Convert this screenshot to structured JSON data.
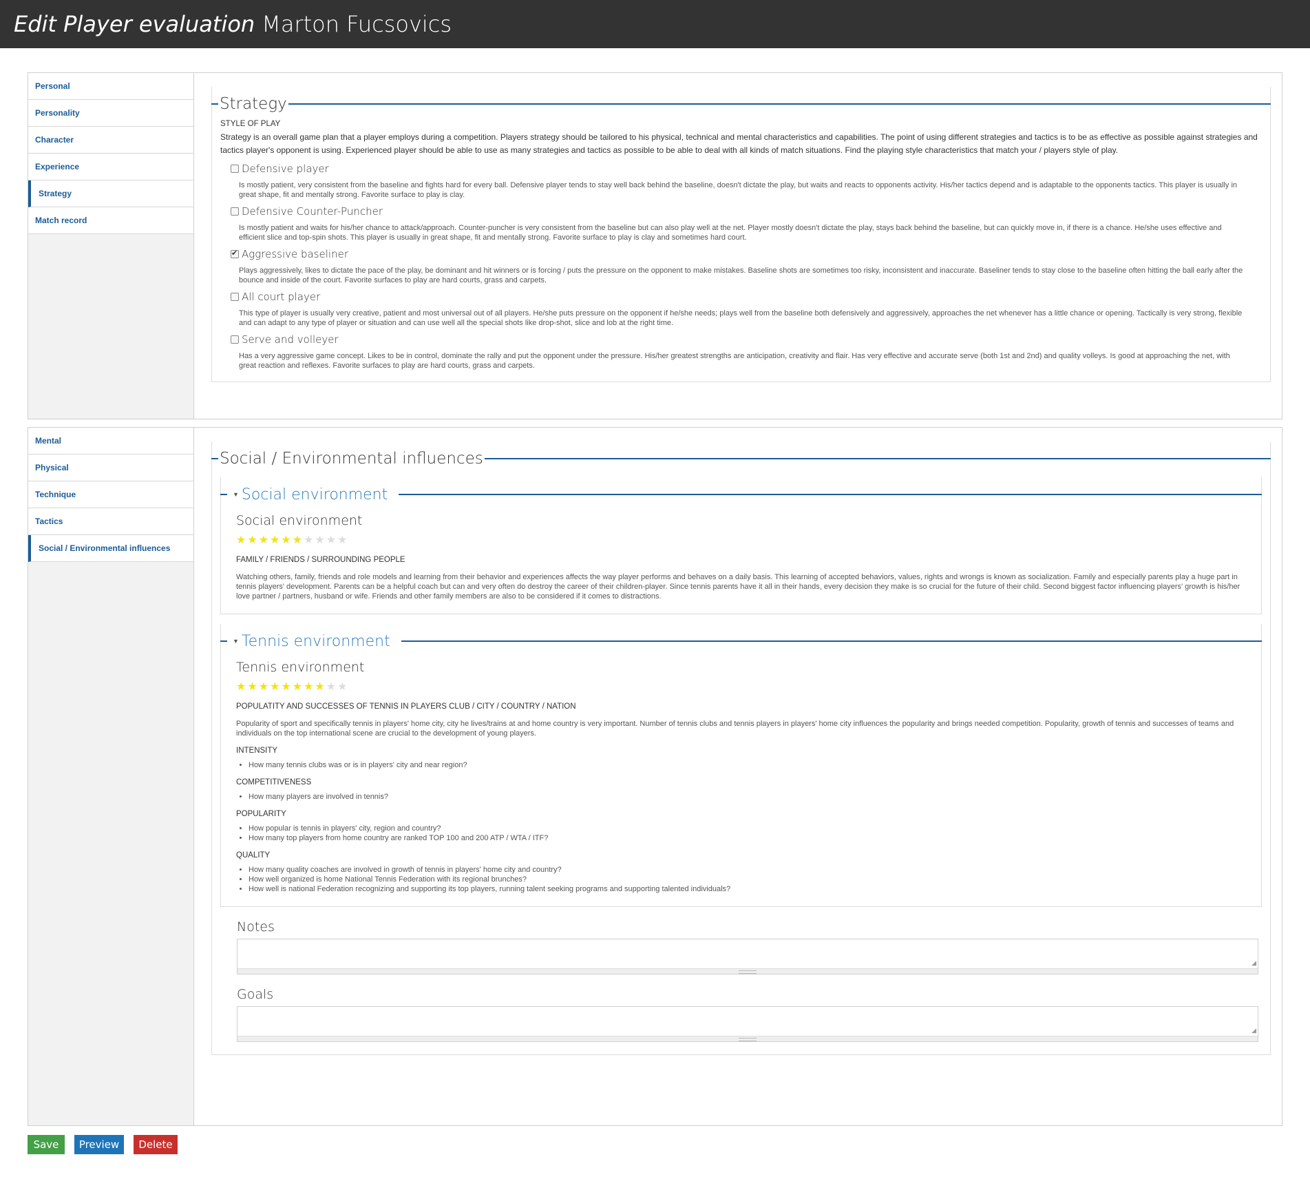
{
  "header": {
    "title": "Edit Player evaluation",
    "player_name": "Marton Fucsovics"
  },
  "nav1": {
    "items": [
      {
        "label": "Personal",
        "active": false
      },
      {
        "label": "Personality",
        "active": false
      },
      {
        "label": "Character",
        "active": false
      },
      {
        "label": "Experience",
        "active": false
      },
      {
        "label": "Strategy",
        "active": true
      },
      {
        "label": "Match record",
        "active": false
      }
    ]
  },
  "strategy": {
    "legend": "Strategy",
    "subheading": "STYLE OF PLAY",
    "intro": "Strategy is an overall game plan that a player employs during a competition. Players strategy should be tailored to his physical, technical and mental characteristics and capabilities. The point of using different strategies and tactics is to be as effective as possible against strategies and tactics player's opponent is using. Experienced player should be able to use as many strategies and tactics as possible to be able to deal with all kinds of match situations. Find the playing style characteristics that match your / players style of play.",
    "options": [
      {
        "label": "Defensive player",
        "checked": false,
        "desc": "Is mostly patient, very consistent from the baseline and fights hard for every ball. Defensive player tends to stay well back behind the baseline, doesn't dictate the play, but waits and reacts to opponents activity. His/her tactics depend and is adaptable to the opponents tactics. This player is usually in great shape, fit and mentally strong. Favorite surface to play is clay."
      },
      {
        "label": "Defensive Counter-Puncher",
        "checked": false,
        "desc": "Is mostly patient and waits for his/her chance to attack/approach. Counter-puncher is very consistent from the baseline but can also play well at the net. Player mostly doesn't dictate the play, stays back behind the baseline, but can quickly move in, if there is a chance. He/she uses effective and efficient slice and top-spin shots. This player is usually in great shape, fit and mentally strong. Favorite surface to play is clay and sometimes hard court."
      },
      {
        "label": "Aggressive baseliner",
        "checked": true,
        "desc": "Plays aggressively, likes to dictate the pace of the play, be dominant and hit winners or is forcing / puts the pressure on the opponent to make mistakes. Baseline shots are sometimes too risky, inconsistent and inaccurate. Baseliner tends to stay close to the baseline often hitting the ball early after the bounce and inside of the court. Favorite surfaces to play are hard courts, grass and carpets."
      },
      {
        "label": "All court player",
        "checked": false,
        "desc": "This type of player is usually very creative, patient and most universal out of all players. He/she puts pressure on the opponent if he/she needs; plays well from the baseline both defensively and aggressively, approaches the net whenever has a little chance or opening. Tactically is very strong, flexible and can adapt to any type of player or situation and can use well all the special shots like drop-shot, slice and lob at the right time."
      },
      {
        "label": "Serve and volleyer",
        "checked": false,
        "desc": "Has a very aggressive game concept. Likes to be in control, dominate the rally and put the opponent under the pressure. His/her greatest strengths are anticipation, creativity and flair. Has very effective and accurate serve (both 1st and 2nd) and quality volleys. Is good at approaching the net, with great reaction and reflexes. Favorite surfaces to play are hard courts, grass and carpets."
      }
    ]
  },
  "nav2": {
    "items": [
      {
        "label": "Mental",
        "active": false
      },
      {
        "label": "Physical",
        "active": false
      },
      {
        "label": "Technique",
        "active": false
      },
      {
        "label": "Tactics",
        "active": false
      },
      {
        "label": "Social / Environmental influences",
        "active": true
      }
    ]
  },
  "social": {
    "legend": "Social / Environmental influences",
    "social_env": {
      "legend": "Social environment",
      "title": "Social environment",
      "rating": 6,
      "max_rating": 10,
      "upper": "FAMILY / FRIENDS / SURROUNDING PEOPLE",
      "desc": "Watching others, family, friends and role models and learning from their behavior and experiences affects the way player performs and behaves on a daily basis. This learning of accepted behaviors, values, rights and wrongs is known as socialization. Family and especially parents play a huge part in tennis players' development. Parents can be a helpful coach but can and very often do destroy the career of their children-player. Since tennis parents have it all in their hands, every decision they make is so crucial for the future of their child. Second biggest factor influencing players' growth is his/her love partner / partners, husband or wife. Friends and other family members are also to be considered if it comes to distractions."
    },
    "tennis_env": {
      "legend": "Tennis environment",
      "title": "Tennis environment",
      "rating": 8,
      "max_rating": 10,
      "upper": "POPULATITY AND SUCCESSES OF TENNIS IN PLAYERS CLUB / CITY / COUNTRY / NATION",
      "desc": "Popularity of sport and specifically tennis in players' home city, city he lives/trains at and home country is very important. Number of tennis clubs and tennis players in players' home city influences the popularity and brings needed competition. Popularity, growth of tennis and successes of teams and individuals on the top international scene are crucial to the development of young players.",
      "groups": [
        {
          "heading": "INTENSITY",
          "items": [
            "How many tennis clubs was or is in players' city and near region?"
          ]
        },
        {
          "heading": "COMPETITIVENESS",
          "items": [
            "How many players are involved in tennis?"
          ]
        },
        {
          "heading": "POPULARITY",
          "items": [
            "How popular is tennis in players' city, region and country?",
            "How many top players from home country are ranked TOP 100 and 200 ATP / WTA / ITF?"
          ]
        },
        {
          "heading": "QUALITY",
          "items": [
            "How many quality coaches are involved in growth of tennis in players' home city and country?",
            "How well organized is home National Tennis Federation with its regional brunches?",
            "How well is national Federation recognizing and supporting its top players, running talent seeking programs and supporting talented individuals?"
          ]
        }
      ]
    },
    "notes_label": "Notes",
    "notes_value": "",
    "goals_label": "Goals",
    "goals_value": ""
  },
  "actions": {
    "save": "Save",
    "preview": "Preview",
    "delete": "Delete"
  },
  "colors": {
    "header_bg": "#333333",
    "accent": "#1a5c99",
    "save": "#43a047",
    "preview": "#1e74b8",
    "delete": "#c9302c",
    "star_on": "#f2e212"
  }
}
